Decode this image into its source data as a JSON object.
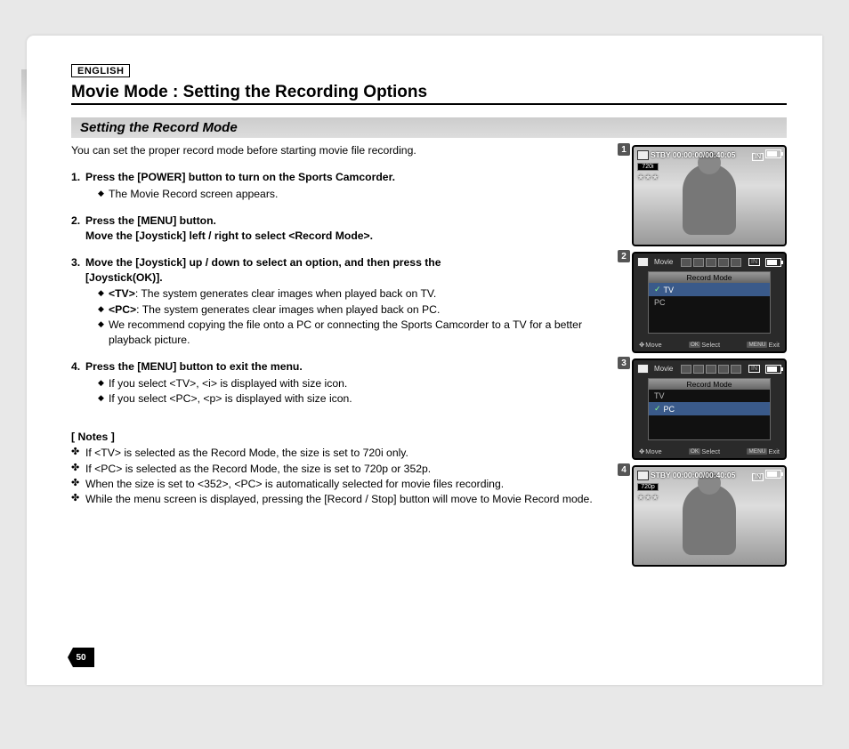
{
  "language_label": "ENGLISH",
  "title": "Movie Mode : Setting the Recording Options",
  "subtitle": "Setting the Record Mode",
  "intro": "You can set the proper record mode before starting movie file recording.",
  "steps": [
    {
      "num": "1.",
      "head": "Press the [POWER] button to turn on the Sports Camcorder.",
      "bullets": [
        "The Movie Record screen appears."
      ]
    },
    {
      "num": "2.",
      "head_line1": "Press the [MENU] button.",
      "head_line2": "Move the [Joystick] left / right to select <Record Mode>.",
      "bullets": []
    },
    {
      "num": "3.",
      "head_line1": "Move the [Joystick] up / down to select an option, and then press the",
      "head_line2": "[Joystick(OK)].",
      "bullets_kv": [
        {
          "label": "<TV>",
          "text": ": The system generates clear images when played back on TV."
        },
        {
          "label": "<PC>",
          "text": ": The system generates clear images when played back on PC."
        },
        {
          "label": "",
          "text": "We recommend copying the file onto a PC or connecting the Sports Camcorder to a TV for a better playback picture."
        }
      ]
    },
    {
      "num": "4.",
      "head": "Press the [MENU] button to exit the menu.",
      "bullets": [
        "If you select <TV>, <i> is displayed with size icon.",
        "If you select <PC>, <p> is displayed with size icon."
      ]
    }
  ],
  "notes_head": "[ Notes ]",
  "notes": [
    "If <TV> is selected as the Record Mode, the size is set to 720i only.",
    "If <PC> is selected as the Record Mode, the size is set to 720p or 352p.",
    "When the size is set to <352>, <PC> is automatically selected for movie files recording.",
    "While the menu screen is displayed, pressing the [Record / Stop] button will move to Movie Record mode."
  ],
  "figs": {
    "f1": {
      "num": "1",
      "status": "STBY",
      "time": "00:00:00/00:40:05",
      "size": "720i",
      "mem": "IN"
    },
    "f2": {
      "num": "2",
      "tab": "Movie",
      "mem": "IN",
      "menu_title": "Record Mode",
      "items": [
        {
          "t": "TV",
          "sel": true,
          "chk": true
        },
        {
          "t": "PC",
          "sel": false,
          "chk": false
        }
      ],
      "move": "Move",
      "select": "Select",
      "exit": "Exit",
      "ok": "OK",
      "menu": "MENU"
    },
    "f3": {
      "num": "3",
      "tab": "Movie",
      "mem": "IN",
      "menu_title": "Record Mode",
      "items": [
        {
          "t": "TV",
          "sel": false,
          "chk": false
        },
        {
          "t": "PC",
          "sel": true,
          "chk": true
        }
      ],
      "move": "Move",
      "select": "Select",
      "exit": "Exit",
      "ok": "OK",
      "menu": "MENU"
    },
    "f4": {
      "num": "4",
      "status": "STBY",
      "time": "00:00:00/00:40:05",
      "size": "720p",
      "mem": "IN"
    }
  },
  "page_number": "50"
}
